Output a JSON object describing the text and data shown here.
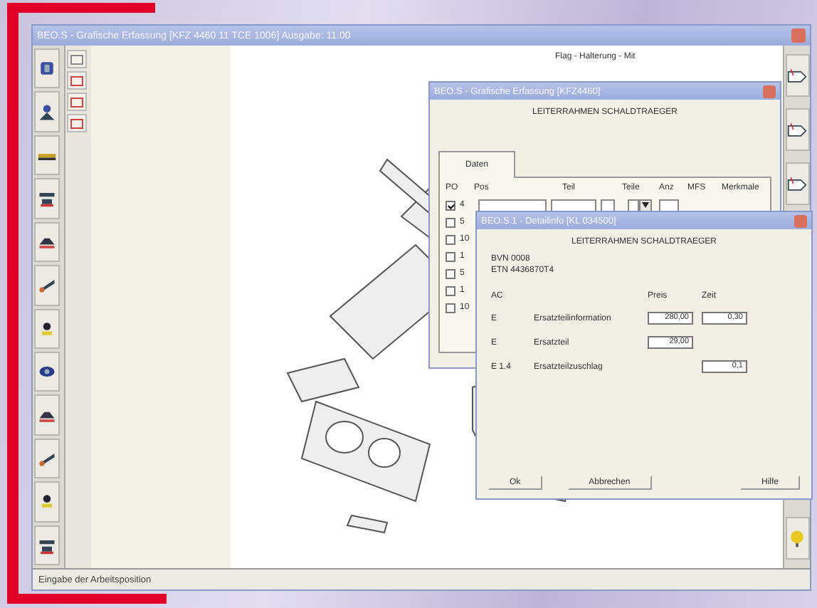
{
  "main_window": {
    "title": "BEO.S - Grafische Erfassung [KFZ 4460 11 TCE 1006]   Ausgabe: 11.00",
    "callout": "Flag - Halterung - Mit",
    "status_bar": "Eingabe der Arbeitsposition"
  },
  "parts_dialog": {
    "title": "BEO.S - Grafische Erfassung [KFZ4460]",
    "heading": "LEITERRAHMEN SCHALDTRAEGER",
    "tabs": [
      {
        "label": "Daten",
        "selected": true
      }
    ],
    "columns": [
      "PO",
      "Pos",
      "Teil",
      "Teile",
      "Anz",
      "MFS",
      "Merkmale"
    ],
    "rows": [
      {
        "label": "4",
        "checked": true
      },
      {
        "label": "5",
        "checked": false
      },
      {
        "label": "10",
        "checked": false
      },
      {
        "label": "1",
        "checked": false
      },
      {
        "label": "5",
        "checked": false
      },
      {
        "label": "1",
        "checked": false
      },
      {
        "label": "10",
        "checked": false
      }
    ]
  },
  "detail_dialog": {
    "title": "BEO.S.1 - Detailinfo [KL 034500]",
    "heading": "LEITERRAHMEN SCHALDTRAEGER",
    "info": [
      "BVN 0008",
      "ETN 4436870T4"
    ],
    "columns": [
      "AC",
      "Preis",
      "Zeit"
    ],
    "rows": [
      {
        "code": "E",
        "label": "Ersatzteilinformation",
        "price": "280,00",
        "time": "0,30"
      },
      {
        "code": "E",
        "label": "Ersatzteil",
        "price": "29,00"
      },
      {
        "code": "E 1.4",
        "label": "Ersatzteilzuschlag",
        "time": "0,1"
      }
    ],
    "buttons": [
      "Ok",
      "Abbrechen",
      "Hilfe"
    ]
  }
}
